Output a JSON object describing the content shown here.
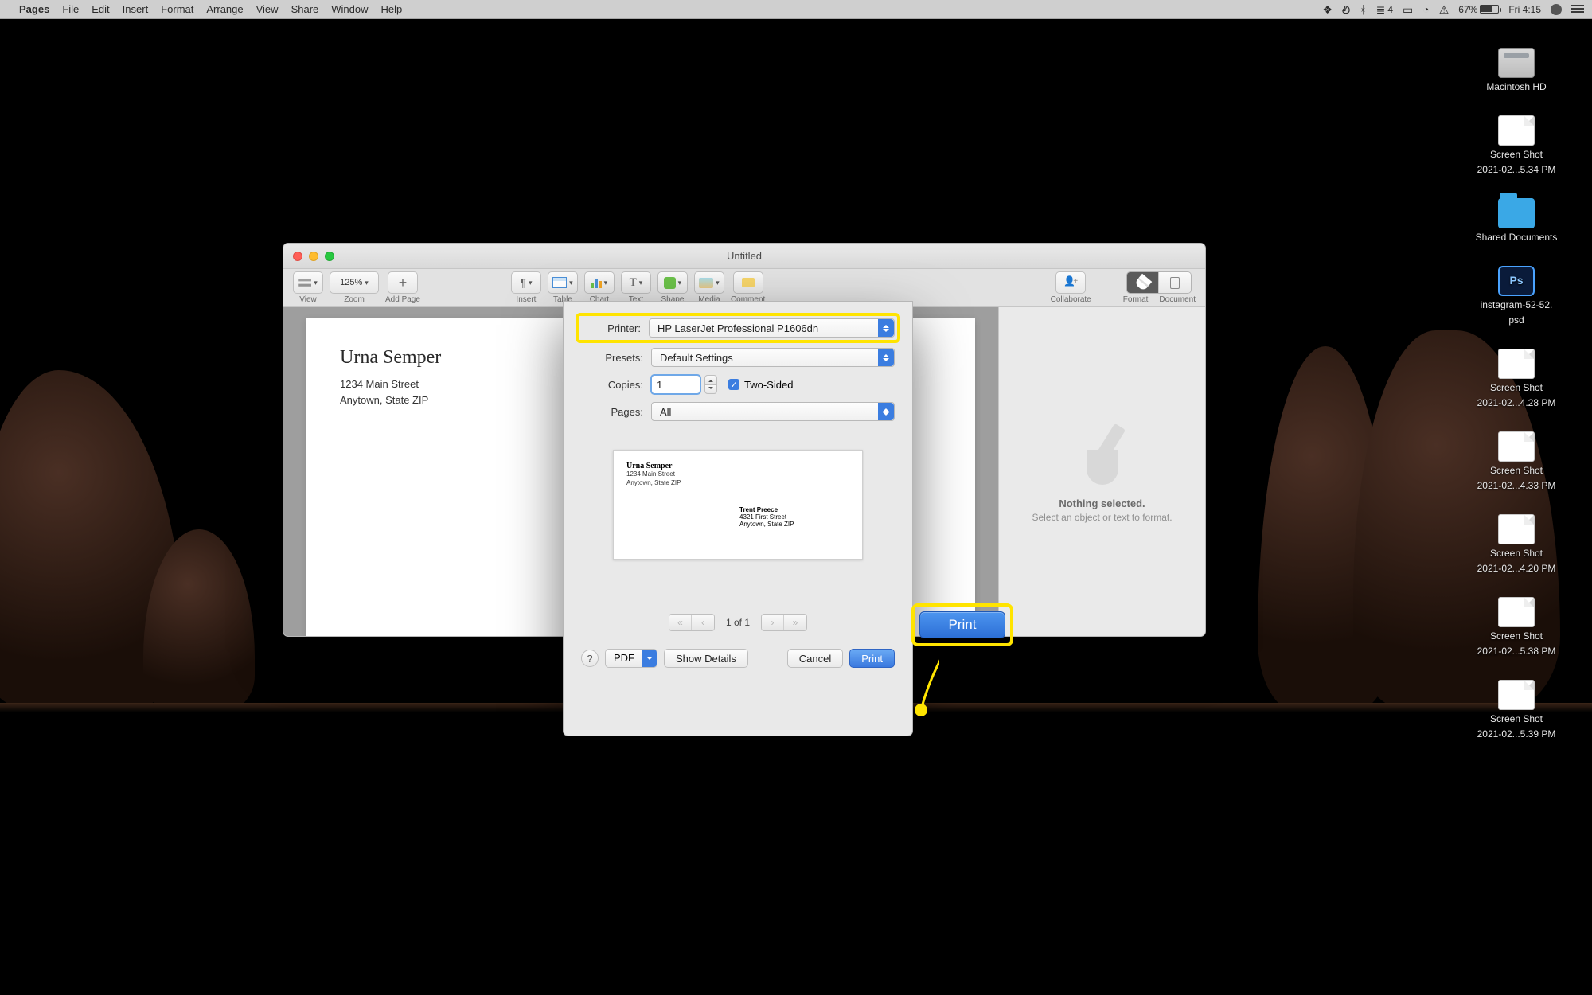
{
  "menubar": {
    "app_active": "Pages",
    "items": [
      "File",
      "Edit",
      "Insert",
      "Format",
      "Arrange",
      "View",
      "Share",
      "Window",
      "Help"
    ],
    "right": {
      "stack_count": "4",
      "battery_pct": "67%",
      "clock": "Fri 4:15"
    }
  },
  "desktop_icons": [
    {
      "type": "hd",
      "label": "Macintosh HD"
    },
    {
      "type": "file",
      "label": "Screen Shot",
      "label2": "2021-02...5.34 PM"
    },
    {
      "type": "folder",
      "label": "Shared Documents"
    },
    {
      "type": "ps",
      "label": "instagram-52-52.",
      "label2": "psd"
    },
    {
      "type": "file",
      "label": "Screen Shot",
      "label2": "2021-02...4.28 PM"
    },
    {
      "type": "file",
      "label": "Screen Shot",
      "label2": "2021-02...4.33 PM"
    },
    {
      "type": "file",
      "label": "Screen Shot",
      "label2": "2021-02...4.20 PM"
    },
    {
      "type": "file",
      "label": "Screen Shot",
      "label2": "2021-02...5.38 PM"
    },
    {
      "type": "file",
      "label": "Screen Shot",
      "label2": "2021-02...5.39 PM"
    }
  ],
  "pages_window": {
    "title": "Untitled",
    "toolbar": {
      "view": "View",
      "zoom_val": "125%",
      "zoom": "Zoom",
      "add_page": "Add Page",
      "insert": "Insert",
      "table": "Table",
      "chart": "Chart",
      "text": "Text",
      "shape": "Shape",
      "media": "Media",
      "comment": "Comment",
      "collaborate": "Collaborate",
      "format": "Format",
      "document": "Document"
    },
    "document": {
      "name": "Urna Semper",
      "addr1": "1234 Main Street",
      "addr2": "Anytown, State ZIP"
    },
    "inspector": {
      "line1": "Nothing selected.",
      "line2": "Select an object or text to format."
    }
  },
  "print_sheet": {
    "labels": {
      "printer": "Printer:",
      "presets": "Presets:",
      "copies": "Copies:",
      "pages": "Pages:",
      "two_sided": "Two-Sided",
      "page_of": "1 of 1"
    },
    "printer": "HP LaserJet Professional P1606dn",
    "presets": "Default Settings",
    "copies": "1",
    "pages": "All",
    "preview": {
      "from_name": "Urna Semper",
      "from_addr": "1234 Main Street\nAnytown, State ZIP",
      "to_name": "Trent Preece",
      "to_addr": "4321 First Street\nAnytown, State ZIP"
    },
    "buttons": {
      "help": "?",
      "pdf": "PDF",
      "show_details": "Show Details",
      "cancel": "Cancel",
      "print": "Print"
    }
  },
  "callout": {
    "print": "Print"
  }
}
